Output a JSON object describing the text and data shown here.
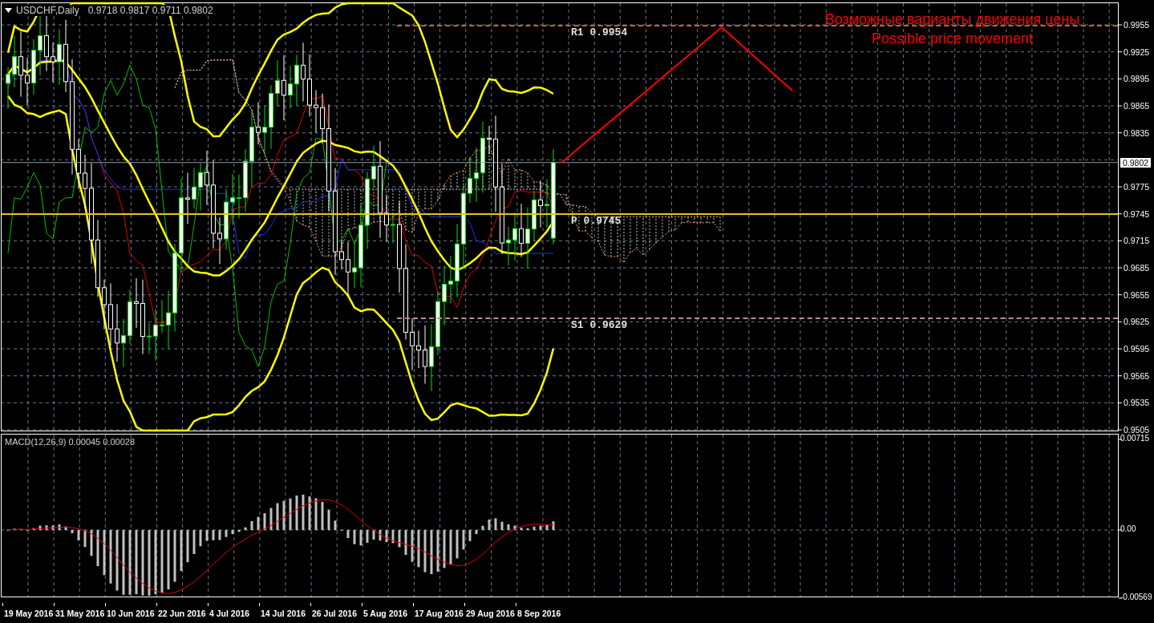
{
  "chart_header": {
    "symbol": "USDCHF,Daily",
    "ohlc": "0.9718 0.9817 0.9711 0.9802"
  },
  "annotation": {
    "lines": [
      "Возможные варианты движения цены",
      "Possible price movement"
    ]
  },
  "pivots": [
    {
      "label": "R1 0.9954",
      "color": "#cd5c3c"
    },
    {
      "label": "P 0.9745",
      "color": "#e6c619"
    },
    {
      "label": "S1 0.9629",
      "color": "#bc8f8f"
    }
  ],
  "price_axis": {
    "ticks": [
      "0.9955",
      "0.9925",
      "0.9895",
      "0.9865",
      "0.9835",
      "0.9775",
      "0.9745",
      "0.9715",
      "0.9685",
      "0.9655",
      "0.9625",
      "0.9595",
      "0.9565",
      "0.9535",
      "0.9505"
    ],
    "current_price": "0.9802"
  },
  "macd": {
    "label": "MACD(12,26,9) 0.00045 0.00028",
    "axis": [
      "0.00715",
      "0.00",
      "-0.00569"
    ]
  },
  "time_axis": {
    "dates": [
      "19 May 2016",
      "31 May 2016",
      "10 Jun 2016",
      "22 Jun 2016",
      "4 Jul 2016",
      "14 Jul 2016",
      "26 Jul 2016",
      "5 Aug 2016",
      "17 Aug 2016",
      "29 Aug 2016",
      "8 Sep 2016"
    ]
  }
}
